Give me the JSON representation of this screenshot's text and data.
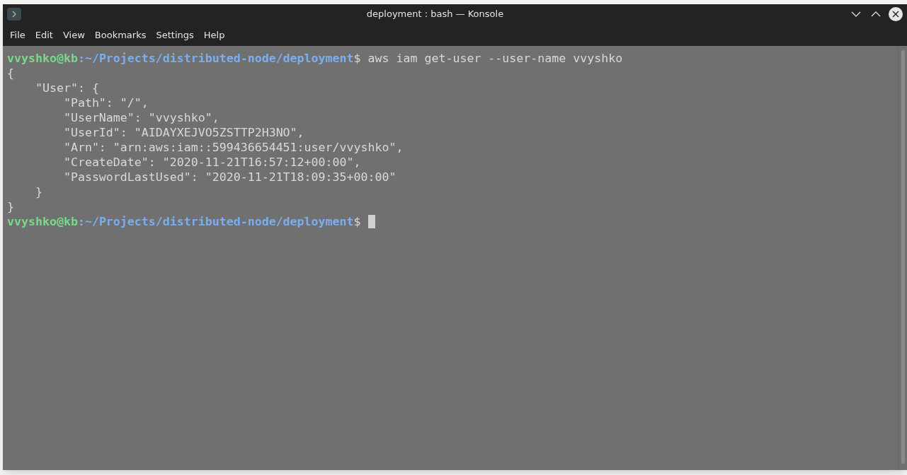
{
  "window": {
    "title": "deployment : bash — Konsole"
  },
  "menu": [
    "File",
    "Edit",
    "View",
    "Bookmarks",
    "Settings",
    "Help"
  ],
  "terminal": {
    "lines": [
      {
        "kind": "prompt",
        "user_host": "vvyshko@kb",
        "path": ":~/Projects/distributed-node/deployment",
        "symbol": "$",
        "command": "aws iam get-user --user-name vvyshko",
        "cursor": false
      },
      {
        "kind": "output",
        "text": "{"
      },
      {
        "kind": "output",
        "text": "    \"User\": {"
      },
      {
        "kind": "output",
        "text": "        \"Path\": \"/\","
      },
      {
        "kind": "output",
        "text": "        \"UserName\": \"vvyshko\","
      },
      {
        "kind": "output",
        "text": "        \"UserId\": \"AIDAYXEJVO5ZSTTP2H3NO\","
      },
      {
        "kind": "output",
        "text": "        \"Arn\": \"arn:aws:iam::599436654451:user/vvyshko\","
      },
      {
        "kind": "output",
        "text": "        \"CreateDate\": \"2020-11-21T16:57:12+00:00\","
      },
      {
        "kind": "output",
        "text": "        \"PasswordLastUsed\": \"2020-11-21T18:09:35+00:00\""
      },
      {
        "kind": "output",
        "text": "    }"
      },
      {
        "kind": "output",
        "text": "}"
      },
      {
        "kind": "prompt",
        "user_host": "vvyshko@kb",
        "path": ":~/Projects/distributed-node/deployment",
        "symbol": "$",
        "cursor": true
      }
    ]
  }
}
